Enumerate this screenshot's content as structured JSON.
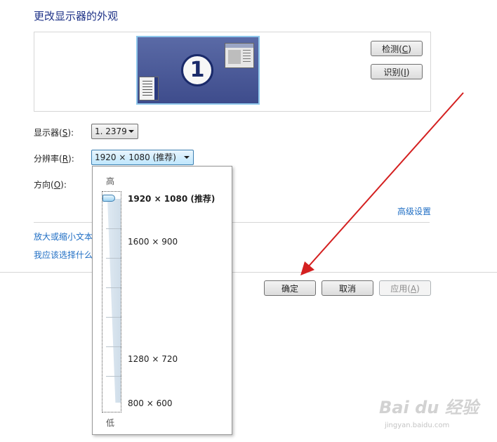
{
  "title": "更改显示器的外观",
  "preview": {
    "monitor_number": "1",
    "detect_label": "检测(",
    "detect_key": "C",
    "detect_end": ")",
    "identify_label": "识别(",
    "identify_key": "I",
    "identify_end": ")"
  },
  "form": {
    "display_label": "显示器(",
    "display_key": "S",
    "display_end": "):",
    "display_value": "1. 2379",
    "resolution_label": "分辨率(",
    "resolution_key": "R",
    "resolution_end": "):",
    "resolution_value": "1920 × 1080 (推荐)",
    "orientation_label": "方向(",
    "orientation_key": "O",
    "orientation_end": "):"
  },
  "links": {
    "advanced": "高级设置",
    "enlarge": "放大或缩小文本",
    "which": "我应该选择什么"
  },
  "buttons": {
    "ok": "确定",
    "cancel": "取消",
    "apply_label": "应用(",
    "apply_key": "A",
    "apply_end": ")"
  },
  "resolution_popup": {
    "high": "高",
    "low": "低",
    "options": [
      "1920 × 1080 (推荐)",
      "1600 × 900",
      "1280 × 720",
      "800 × 600"
    ],
    "selected_index": 0
  },
  "watermark": {
    "brand": "Bai du 经验",
    "url": "jingyan.baidu.com"
  },
  "colors": {
    "title": "#1e3287",
    "link": "#1f6ec4",
    "arrow": "#d42020"
  }
}
